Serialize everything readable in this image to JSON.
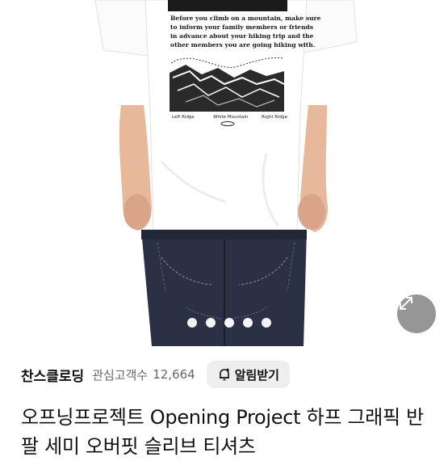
{
  "product": {
    "shirt_print": {
      "paragraph": [
        "Before you climb on a mountain, make sure",
        "to inform your family members or friends",
        "in advance about your hiking trip and the",
        "other members you are going hiking with."
      ],
      "mountain_labels": [
        "Left Ridge",
        "White Mountain",
        "Right Ridge"
      ]
    },
    "carousel": {
      "pages": 5
    },
    "store": {
      "name": "찬스클로딩",
      "interest_label": "관심고객수",
      "interest_count": "12,664",
      "alarm_label": "알림받기"
    },
    "title": "오프닝프로젝트 Opening Project 하프 그래픽 반팔 세미 오버핏 슬리브 티셔츠"
  },
  "icons": {
    "expand": "expand-arrows-icon",
    "alarm": "bell-plus-icon"
  }
}
